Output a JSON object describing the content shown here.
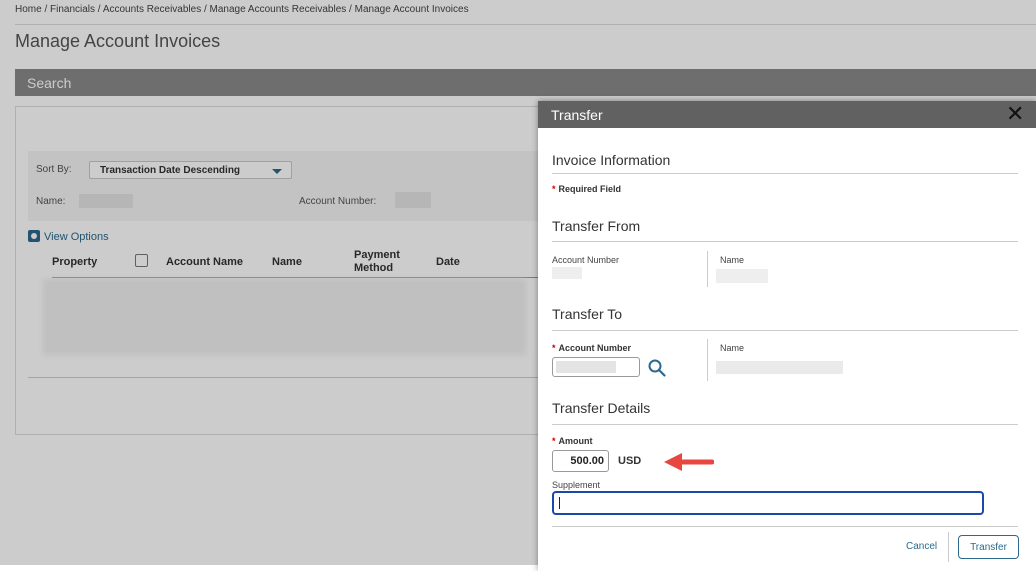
{
  "breadcrumb": "Home / Financials / Accounts Receivables / Manage Accounts Receivables / Manage Account Invoices",
  "page": {
    "title": "Manage Account Invoices"
  },
  "search": {
    "label": "Search",
    "sort_by_label": "Sort By:",
    "sort_value": "Transaction Date Descending",
    "name_label": "Name:",
    "account_number_label": "Account Number:",
    "view_options": "View Options"
  },
  "table": {
    "columns": {
      "property": "Property",
      "account_name": "Account Name",
      "name": "Name",
      "payment_method": "Payment Method",
      "date": "Date"
    }
  },
  "dialog": {
    "title": "Transfer",
    "close_icon": "close-icon",
    "invoice_information": "Invoice Information",
    "required_field": "Required Field",
    "transfer_from": {
      "title": "Transfer From",
      "account_number_label": "Account Number",
      "name_label": "Name"
    },
    "transfer_to": {
      "title": "Transfer To",
      "account_number_label": "Account Number",
      "name_label": "Name",
      "search_icon": "search-icon"
    },
    "transfer_details": {
      "title": "Transfer Details",
      "amount_label": "Amount",
      "amount_value": "500.00",
      "currency": "USD",
      "supplement_label": "Supplement",
      "supplement_value": ""
    },
    "cancel_label": "Cancel",
    "transfer_label": "Transfer"
  },
  "colors": {
    "accent": "#2b6a8c",
    "dialog_header": "#616161",
    "required_star": "#cc0000",
    "annotation_arrow": "#e8473f",
    "focus_border": "#1a4aa8"
  }
}
